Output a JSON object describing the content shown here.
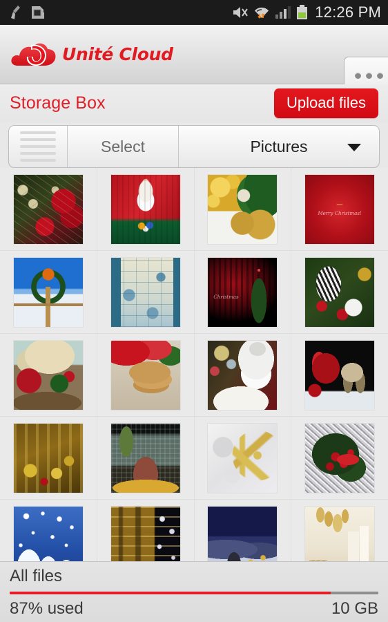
{
  "status_bar": {
    "icons_left": [
      "broom-cleaner-icon",
      "sim-card-icon"
    ],
    "icons_right": [
      "mute-icon",
      "wifi-data-transfer-icon",
      "signal-bars-icon",
      "battery-icon"
    ],
    "time": "12:26 PM",
    "background_color": "#1b1b1b"
  },
  "app_header": {
    "logo_name": "unite-cloud-logo",
    "brand_text": "Unité Cloud",
    "brand_color": "#e01b22",
    "overflow_menu_label": "•••"
  },
  "title_row": {
    "page_title": "Storage Box",
    "title_color": "#e02028",
    "upload_button_label": "Upload files",
    "upload_button_color": "#d90f17"
  },
  "toolbar": {
    "list_view_icon": "list-view-icon",
    "select_label": "Select",
    "folder_label": "Pictures",
    "dropdown_icon": "chevron-down-icon",
    "folder_options": [
      "Pictures"
    ]
  },
  "gallery": {
    "columns": 4,
    "items": [
      {
        "name": "christmas-tree-poinsettia",
        "caption": ""
      },
      {
        "name": "santa-figurine-gift-sack",
        "caption": ""
      },
      {
        "name": "gold-baubles-pine",
        "caption": ""
      },
      {
        "name": "merry-christmas-red-card",
        "caption": "Merry Christmas!"
      },
      {
        "name": "snow-wreath-fence",
        "caption": ""
      },
      {
        "name": "blue-winter-illustration",
        "caption": ""
      },
      {
        "name": "red-curtain-tree",
        "caption": "Christmas"
      },
      {
        "name": "ornament-wreath-closeup",
        "caption": ""
      },
      {
        "name": "gift-basket-candle",
        "caption": ""
      },
      {
        "name": "cookies-candy-canes",
        "caption": ""
      },
      {
        "name": "santa-reading-letters",
        "caption": ""
      },
      {
        "name": "santa-sleigh-reindeer",
        "caption": ""
      },
      {
        "name": "golden-market-lights",
        "caption": ""
      },
      {
        "name": "rockefeller-center-tree",
        "caption": ""
      },
      {
        "name": "gold-snowflake-bokeh",
        "caption": ""
      },
      {
        "name": "red-berries-silver-tinsel",
        "caption": ""
      },
      {
        "name": "snowfall-blue-trees",
        "caption": ""
      },
      {
        "name": "lit-building-stars",
        "caption": ""
      },
      {
        "name": "snowy-night-village",
        "caption": ""
      },
      {
        "name": "candles-gold-ornaments",
        "caption": ""
      }
    ]
  },
  "storage_footer": {
    "scope_label": "All files",
    "percent_used_label": "87% used",
    "percent_value": 87,
    "quota_label": "10 GB",
    "bar_color": "#e02028"
  }
}
